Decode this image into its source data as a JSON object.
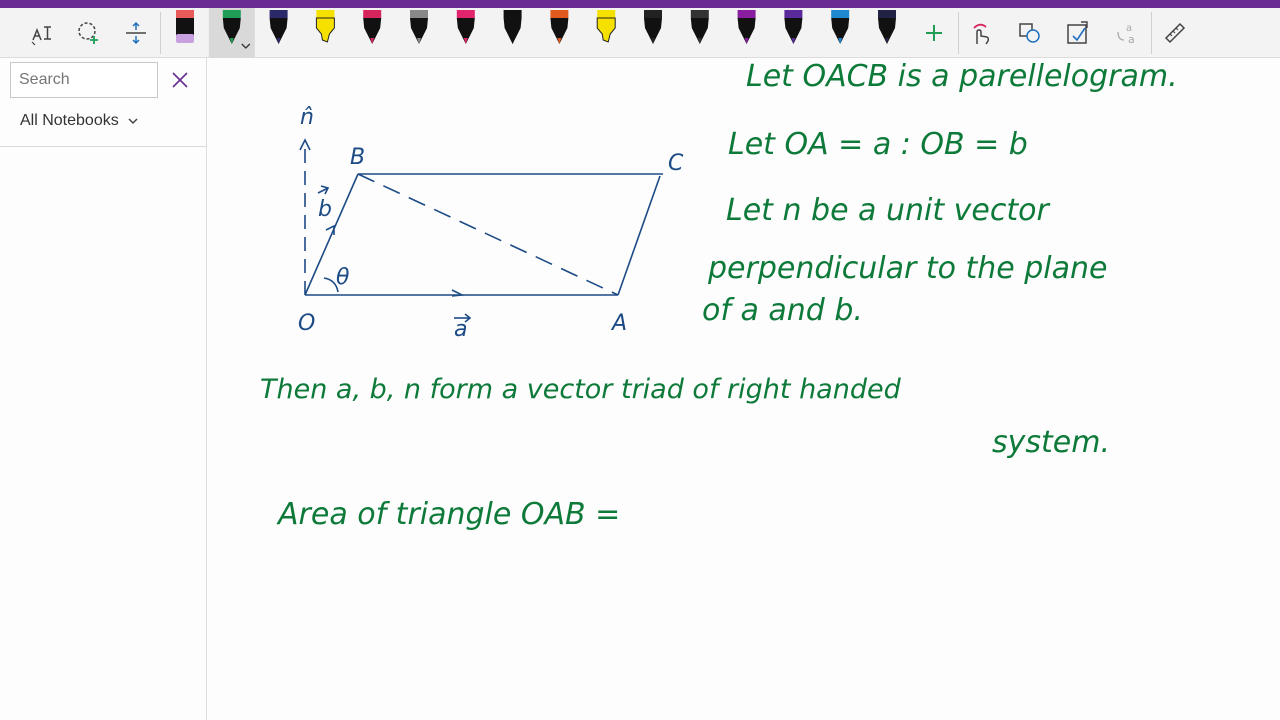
{
  "colors": {
    "accent_purple": "#6a2c91",
    "ink_green": "#0e7a3a",
    "ink_blue": "#1d4b86"
  },
  "toolbar": {
    "icons": [
      "lasso-select-text-icon",
      "lasso-select-icon",
      "add-space-icon",
      "add-pen-icon",
      "touch-draw-icon",
      "ink-to-shape-icon",
      "ink-to-text-icon",
      "ink-to-math-icon",
      "ruler-icon"
    ],
    "pens": [
      {
        "color": "#e85a5a",
        "tip": "#c8a0e0",
        "kind": "eraser"
      },
      {
        "color": "#1f9d55",
        "kind": "pen",
        "active": true
      },
      {
        "color": "#2a2a6a",
        "kind": "pen"
      },
      {
        "color": "#f5e000",
        "kind": "highlighter"
      },
      {
        "color": "#d6245c",
        "kind": "pen"
      },
      {
        "color": "#888888",
        "kind": "pen"
      },
      {
        "color": "#e0246e",
        "kind": "pen"
      },
      {
        "color": "#111111",
        "kind": "pen"
      },
      {
        "color": "#e05a1e",
        "kind": "pen"
      },
      {
        "color": "#f5e000",
        "kind": "highlighter"
      },
      {
        "color": "#222222",
        "kind": "pen"
      },
      {
        "color": "#333333",
        "kind": "pen"
      },
      {
        "color": "#8a1ea0",
        "kind": "pen"
      },
      {
        "color": "#5a2a9a",
        "kind": "pen"
      },
      {
        "color": "#1e88d0",
        "kind": "pen"
      },
      {
        "color": "#222244",
        "kind": "pen"
      }
    ]
  },
  "sidebar": {
    "search_placeholder": "Search",
    "notebooks_label": "All Notebooks"
  },
  "notes": {
    "line1": "Let OACB is a parellelogram.",
    "line2": "Let OA = a : OB = b",
    "line3": "Let n be a unit vector",
    "line4": "perpendicular to the plane",
    "line5": "of a and b.",
    "line6": "Then a, b, n form a vector triad of right handed",
    "line7": "system.",
    "line8": "Area of triangle OAB ="
  },
  "diagram": {
    "label_n": "n̂",
    "label_B": "B",
    "label_C": "C",
    "label_b": "b",
    "label_theta": "θ",
    "label_O": "O",
    "label_a": "a",
    "label_A": "A"
  }
}
